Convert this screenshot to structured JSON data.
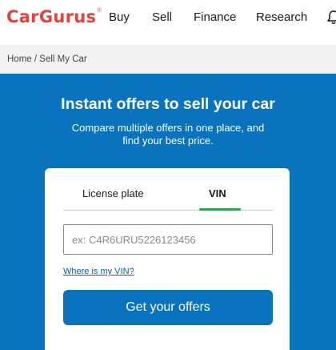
{
  "brand": {
    "logo_text": "CarGurus",
    "reg_mark": "®",
    "color": "#e8403a"
  },
  "nav": {
    "items": [
      "Buy",
      "Sell",
      "Finance",
      "Research"
    ],
    "bell_icon": "bell-icon"
  },
  "breadcrumb": {
    "home": "Home",
    "separator": "/",
    "current": "Sell My Car"
  },
  "hero": {
    "title": "Instant offers to sell your car",
    "subtitle": "Compare multiple offers in one place, and find your best price.",
    "background": "#0a73be"
  },
  "form": {
    "tabs": [
      {
        "label": "License plate",
        "active": false
      },
      {
        "label": "VIN",
        "active": true
      }
    ],
    "active_tab_color": "#2aa84a",
    "vin_placeholder": "ex: C4R6URU5226123456",
    "vin_value": "",
    "vin_help_link": "Where is my VIN?",
    "submit_label": "Get your offers"
  }
}
